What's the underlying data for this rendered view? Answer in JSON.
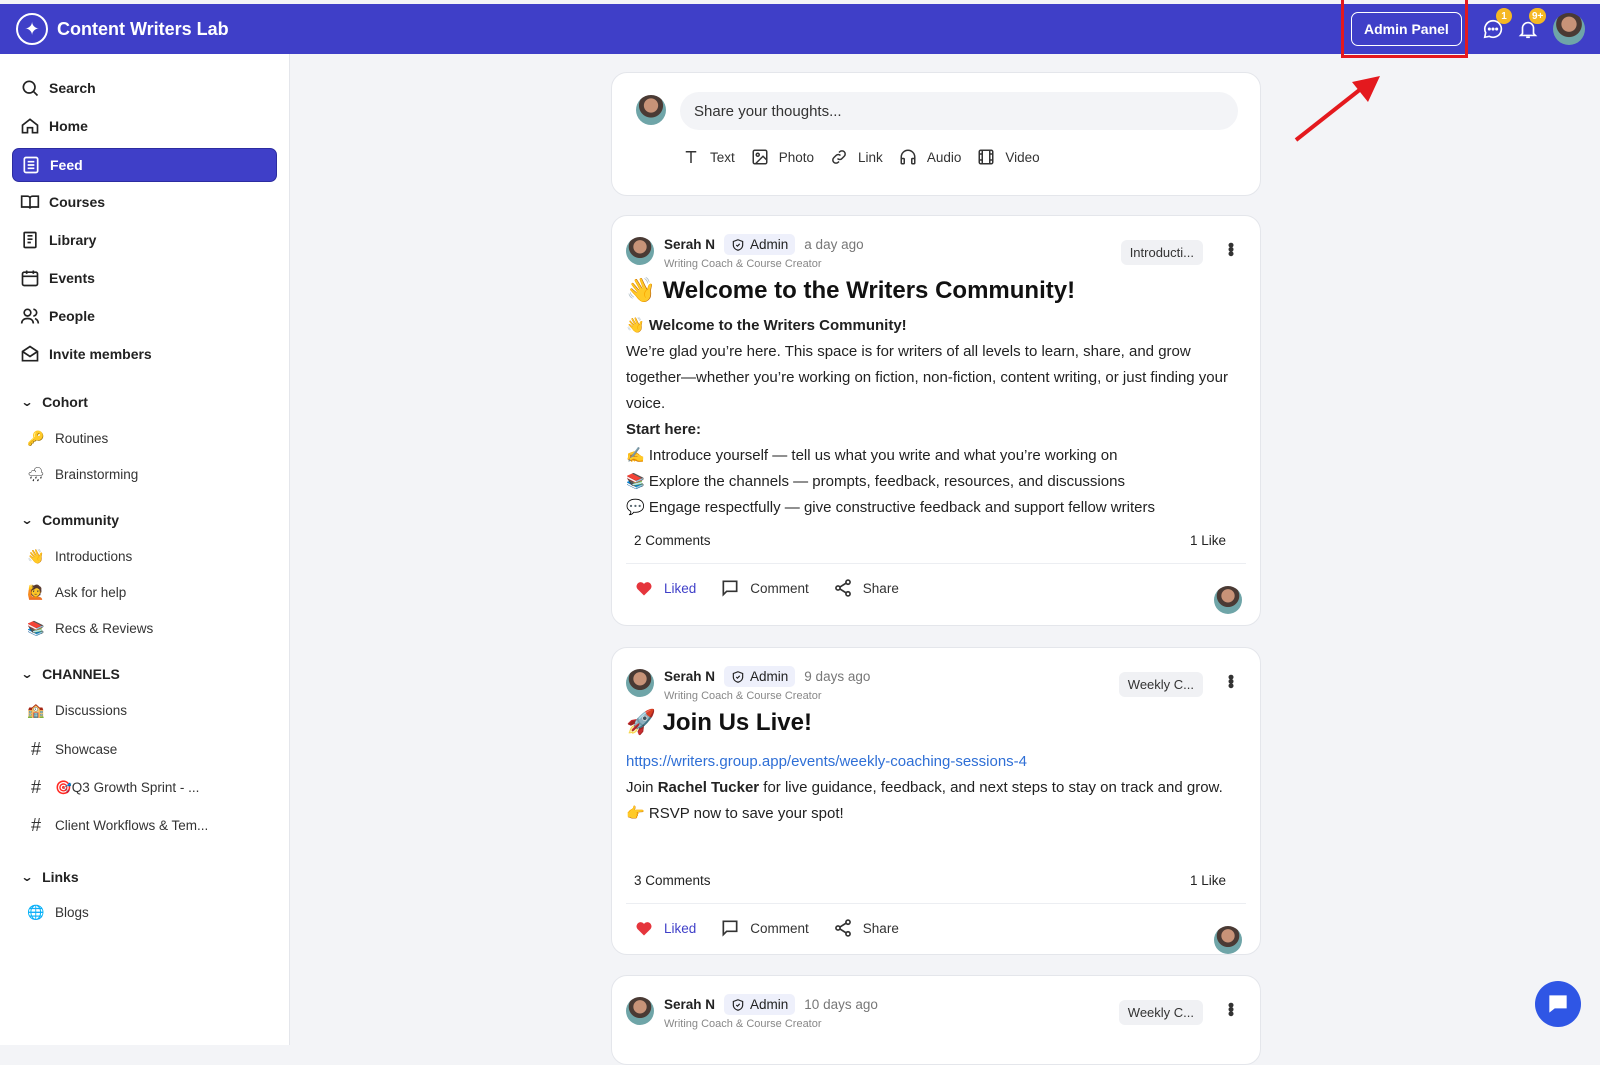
{
  "app": {
    "name": "Content Writers Lab"
  },
  "topbar": {
    "admin_panel_label": "Admin Panel",
    "messages_badge": "1",
    "notifications_badge": "9+"
  },
  "sidebar": {
    "nav": [
      {
        "label": "Search",
        "icon": "search-icon"
      },
      {
        "label": "Home",
        "icon": "home-icon"
      },
      {
        "label": "Feed",
        "icon": "feed-icon",
        "active": true
      },
      {
        "label": "Courses",
        "icon": "book-icon"
      },
      {
        "label": "Library",
        "icon": "library-icon"
      },
      {
        "label": "Events",
        "icon": "calendar-icon"
      },
      {
        "label": "People",
        "icon": "people-icon"
      },
      {
        "label": "Invite members",
        "icon": "mail-icon"
      }
    ],
    "sections": [
      {
        "title": "Cohort",
        "items": [
          {
            "label": "Routines",
            "icon": "🔑"
          },
          {
            "label": "Brainstorming",
            "icon": "🌧"
          }
        ]
      },
      {
        "title": "Community",
        "items": [
          {
            "label": "Introductions",
            "icon": "👋"
          },
          {
            "label": "Ask for help",
            "icon": "🙋"
          },
          {
            "label": "Recs & Reviews",
            "icon": "📚"
          }
        ]
      },
      {
        "title": "CHANNELS",
        "items": [
          {
            "label": "Discussions",
            "icon": "🏫"
          },
          {
            "label": "Showcase",
            "icon": "#"
          },
          {
            "label": "🎯Q3 Growth Sprint - ...",
            "icon": "#"
          },
          {
            "label": "Client Workflows & Tem...",
            "icon": "#"
          }
        ]
      },
      {
        "title": "Links",
        "items": [
          {
            "label": "Blogs",
            "icon": "🌐"
          }
        ]
      }
    ]
  },
  "composer": {
    "placeholder": "Share your thoughts...",
    "tools": [
      "Text",
      "Photo",
      "Link",
      "Audio",
      "Video"
    ]
  },
  "posts": [
    {
      "author": "Serah N",
      "role": "Admin",
      "time": "a day ago",
      "subtitle": "Writing Coach & Course Creator",
      "channel": "Introducti...",
      "title_emoji": "👋",
      "title": "Welcome to the Writers Community!",
      "body_heading": "Welcome to the Writers Community!",
      "body_intro": "We’re glad you’re here. This space is for writers of all levels to learn, share, and grow together—whether you’re working on fiction, non-fiction, content writing, or just finding your voice.",
      "start_here": "Start here:",
      "bullets": [
        {
          "icon": "✍️",
          "text": "Introduce yourself — tell us what you write and what you’re working on"
        },
        {
          "icon": "📚",
          "text": "Explore the channels — prompts, feedback, resources, and discussions"
        },
        {
          "icon": "💬",
          "text": "Engage respectfully — give constructive feedback and support fellow writers"
        }
      ],
      "comments": "2 Comments",
      "likes": "1 Like",
      "actions": {
        "liked": "Liked",
        "comment": "Comment",
        "share": "Share"
      }
    },
    {
      "author": "Serah N",
      "role": "Admin",
      "time": "9 days ago",
      "subtitle": "Writing Coach & Course Creator",
      "channel": "Weekly C...",
      "title_emoji": "🚀",
      "title": "Join Us Live!",
      "link": "https://writers.group.app/events/weekly-coaching-sessions-4",
      "join_prefix": "Join ",
      "join_name": "Rachel Tucker",
      "join_suffix": " for live guidance, feedback, and next steps to stay on track and grow.",
      "rsvp_icon": "👉",
      "rsvp": "RSVP now to save your spot!",
      "comments": "3 Comments",
      "likes": "1 Like",
      "actions": {
        "liked": "Liked",
        "comment": "Comment",
        "share": "Share"
      }
    },
    {
      "author": "Serah N",
      "role": "Admin",
      "time": "10 days ago",
      "subtitle": "Writing Coach & Course Creator",
      "channel": "Weekly C..."
    }
  ],
  "colors": {
    "brand": "#3f3fc8",
    "highlight": "#e4191e",
    "badge": "#f5b823",
    "link": "#2f6fd6",
    "heart": "#e5353c"
  }
}
